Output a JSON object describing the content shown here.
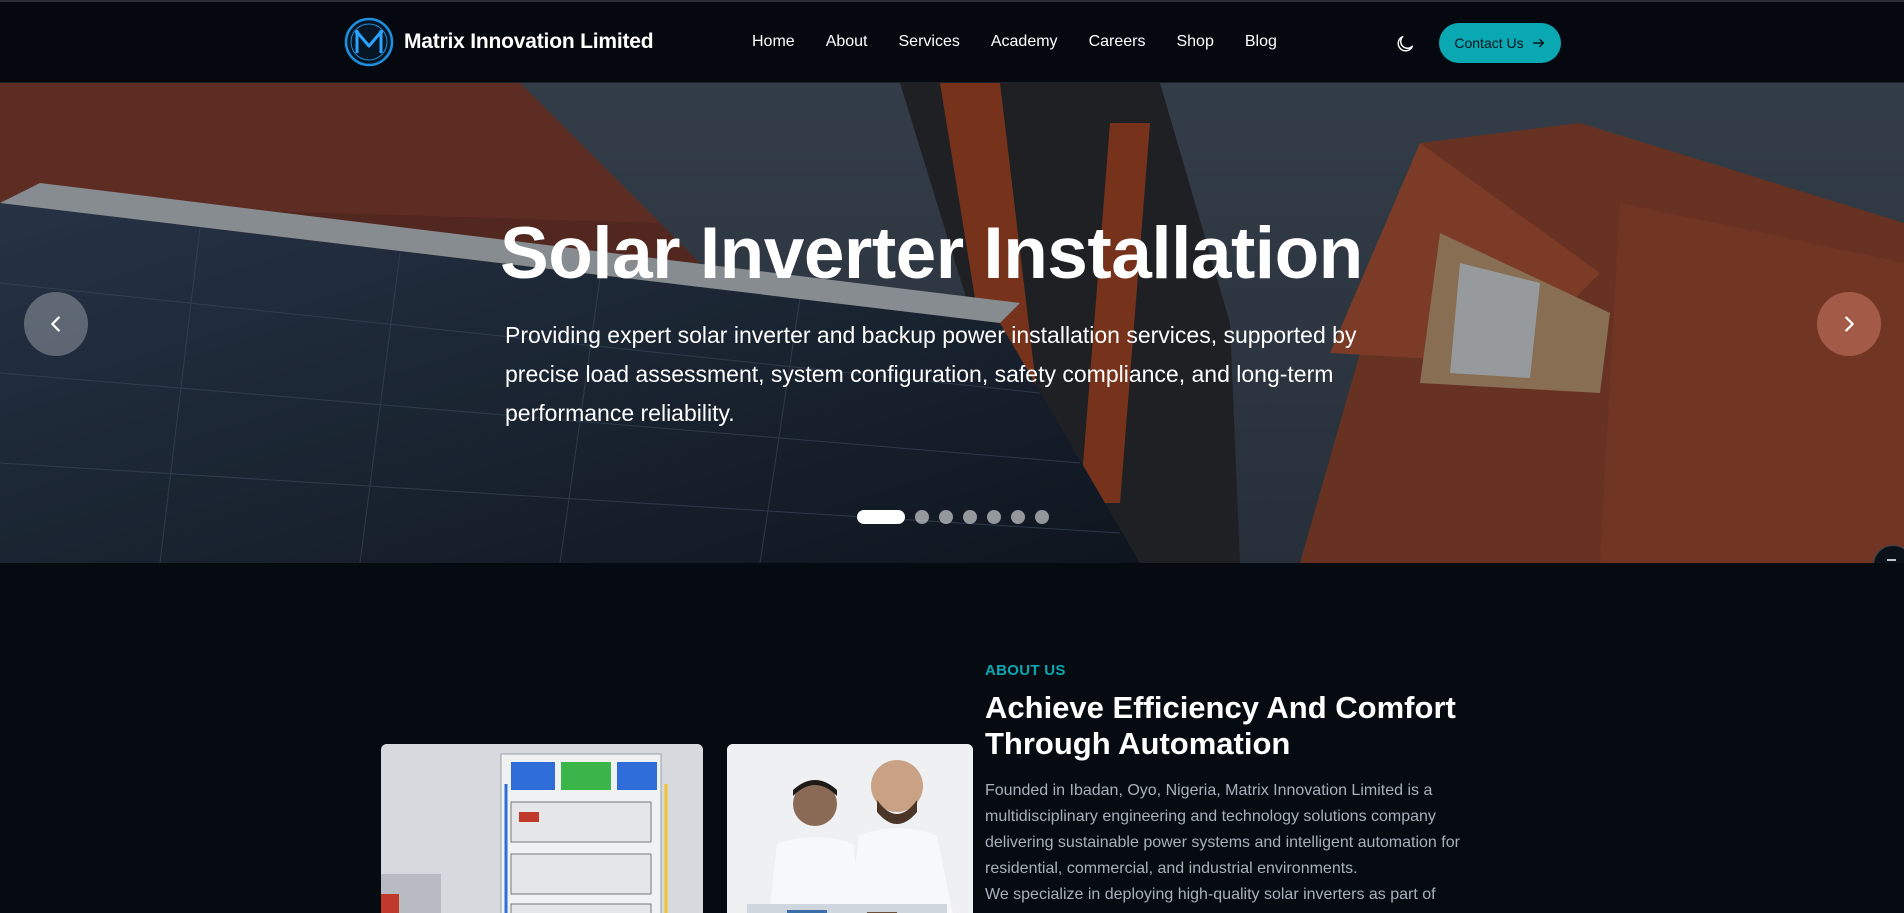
{
  "header": {
    "brand": "Matrix Innovation Limited",
    "nav": [
      "Home",
      "About",
      "Services",
      "Academy",
      "Careers",
      "Shop",
      "Blog"
    ],
    "cta_label": "Contact Us"
  },
  "hero": {
    "title": "Solar Inverter Installation",
    "subtitle": "Providing expert solar inverter and backup power installation services, supported by precise load assessment, system configuration, safety compliance, and long-term performance reliability.",
    "slide_count": 7,
    "active_slide": 1
  },
  "about": {
    "label": "ABOUT US",
    "title": "Achieve Efficiency And Comfort Through Automation",
    "paragraph1": "Founded in Ibadan, Oyo, Nigeria, Matrix Innovation Limited is a multidisciplinary engineering and technology solutions company delivering sustainable power systems and intelligent automation for residential, commercial, and industrial environments.",
    "paragraph2": "We specialize in deploying high-quality solar inverters as part of"
  },
  "colors": {
    "accent": "#0aa8b2",
    "page_bg": "#060b12",
    "header_bg": "#05090f"
  },
  "icons": {
    "logo": "matrix-m-logo-icon",
    "theme_toggle": "moon-icon",
    "cta": "arrow-right-icon",
    "prev": "chevron-left-icon",
    "next": "chevron-right-icon",
    "side": "settings-list-icon"
  }
}
